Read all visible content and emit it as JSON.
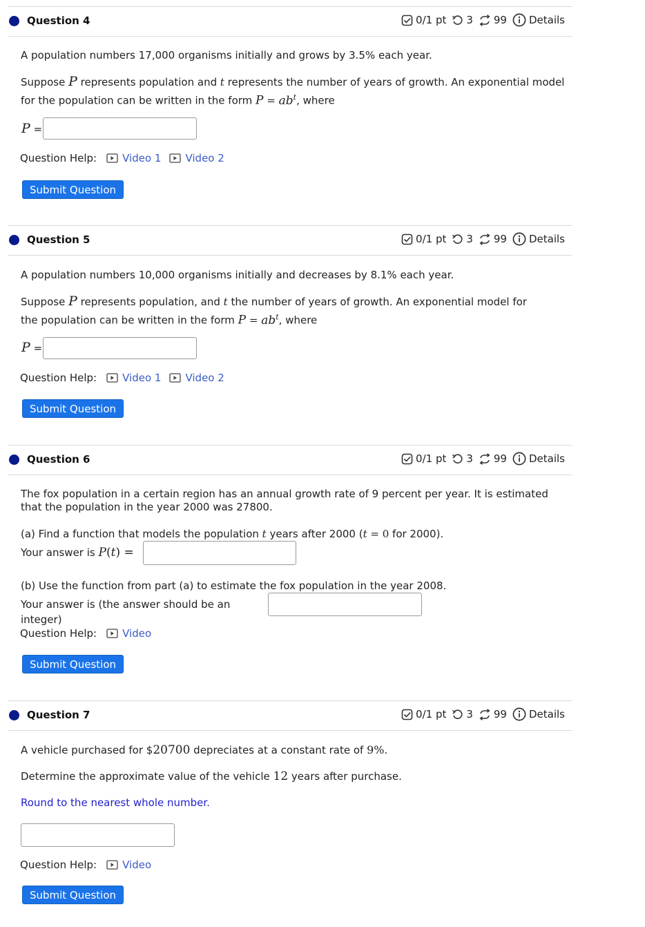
{
  "common": {
    "score": "0/1 pt",
    "retries": "3",
    "attempts": "99",
    "details": "Details",
    "help_label": "Question Help:",
    "video1": "Video 1",
    "video2": "Video 2",
    "video": "Video",
    "submit": "Submit Question",
    "p_label": "P",
    "equals": "="
  },
  "q4": {
    "title": "Question 4",
    "line1": "A population numbers 17,000 organisms initially and grows by 3.5% each year.",
    "line2a": "Suppose ",
    "line2b": " represents population and ",
    "line2c": " represents the number of years of growth. An exponential model for the population can be written in the form ",
    "line2d": ", where"
  },
  "q5": {
    "title": "Question 5",
    "line1": "A population numbers 10,000 organisms initially and decreases by 8.1% each year.",
    "line2a": "Suppose ",
    "line2b": " represents population, and ",
    "line2c": " the number of years of growth. An exponential model for the population can be written in the form ",
    "line2d": ", where"
  },
  "q6": {
    "title": "Question 6",
    "line1": "The fox population in a certain region has an annual growth rate of 9 percent per year. It is estimated that the population in the year 2000 was 27800.",
    "parta_a": "(a) Find a function that models the population ",
    "parta_b": " years after 2000 (",
    "parta_c": " for 2000).",
    "answer_a": "Your answer is ",
    "partb": "(b) Use the function from part (a) to estimate the fox population in the year 2008.",
    "answer_b": "Your answer is (the answer should be an integer)"
  },
  "q7": {
    "title": "Question 7",
    "line1a": "A vehicle purchased for $",
    "amount": "20700",
    "line1b": " depreciates at a constant rate of ",
    "rate": "9%",
    "line1c": ".",
    "line2a": "Determine the approximate value of the vehicle ",
    "years": "12",
    "line2b": " years after purchase.",
    "round": "Round to the nearest whole number."
  }
}
